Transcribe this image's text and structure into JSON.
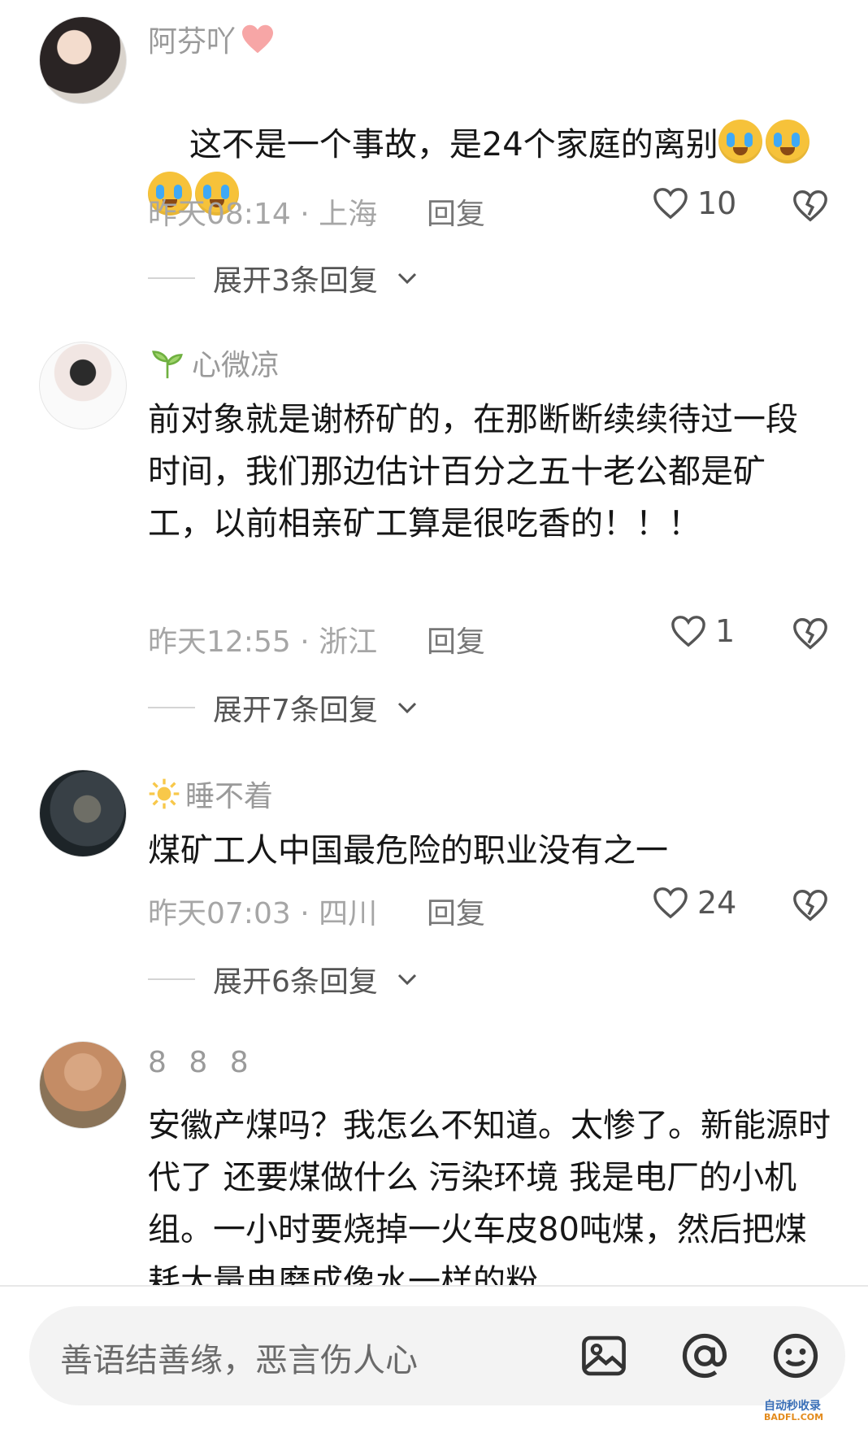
{
  "comments": [
    {
      "username": "阿芬吖",
      "text": "这不是一个事故，是24个家庭的离别",
      "emoji_count": 4,
      "time": "昨天08:14",
      "location": "上海",
      "reply_label": "回复",
      "likes": "10",
      "expand_label": "展开3条回复"
    },
    {
      "username": "心微凉",
      "text": "前对象就是谢桥矿的，在那断断续续待过一段时间，我们那边估计百分之五十老公都是矿工，以前相亲矿工算是很吃香的！！！",
      "time": "昨天12:55",
      "location": "浙江",
      "reply_label": "回复",
      "likes": "1",
      "expand_label": "展开7条回复"
    },
    {
      "username": "睡不着",
      "text": "煤矿工人中国最危险的职业没有之一",
      "time": "昨天07:03",
      "location": "四川",
      "reply_label": "回复",
      "likes": "24",
      "expand_label": "展开6条回复"
    },
    {
      "username": "8 8 8",
      "text": "安徽产煤吗？我怎么不知道。太惨了。新能源时代了 还要煤做什么 污染环境 我是电厂的小机组。一小时要烧掉一火车皮80吨煤，然后把煤耗大量电磨成像水一样的粉"
    }
  ],
  "input": {
    "placeholder": "善语结善缘，恶言伤人心"
  },
  "icons": {
    "like": "heart-outline-icon",
    "dislike": "broken-heart-icon",
    "expand": "chevron-down-icon",
    "image": "image-icon",
    "mention": "at-icon",
    "emoji": "smile-icon"
  },
  "watermark": {
    "line1": "自动秒收录",
    "line2": "BADFL.COM"
  },
  "colors": {
    "accent_heart": "#f7a6a6",
    "meta_gray": "#a6a6a6",
    "text": "#161616"
  }
}
